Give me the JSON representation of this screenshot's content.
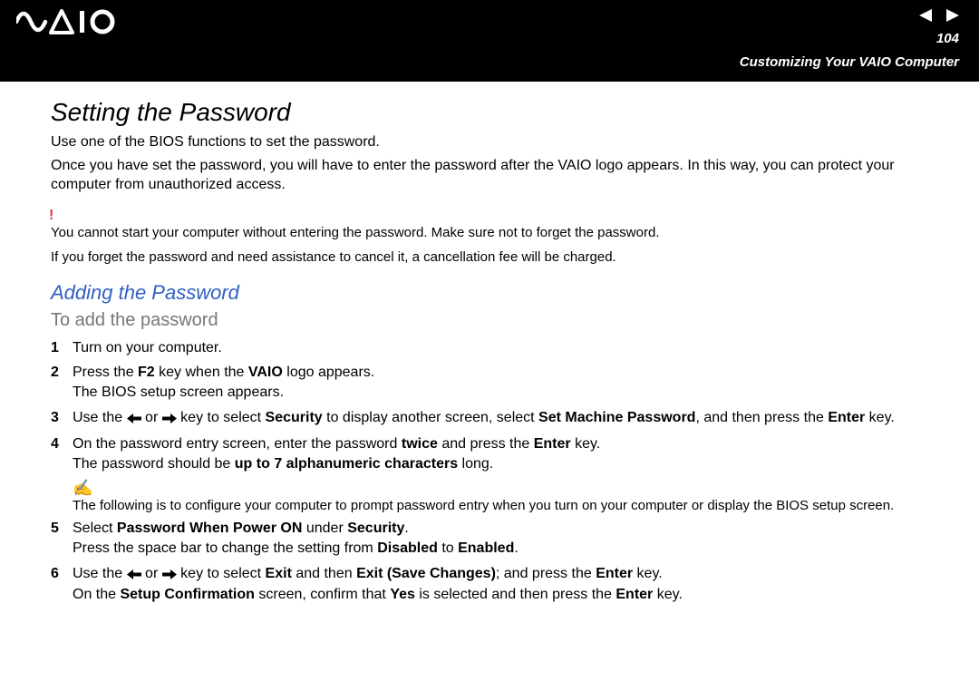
{
  "header": {
    "page_number": "104",
    "section": "Customizing Your VAIO Computer"
  },
  "main": {
    "h1": "Setting the Password",
    "intro1": "Use one of the BIOS functions to set the password.",
    "intro2": "Once you have set the password, you will have to enter the password after the VAIO logo appears. In this way, you can protect your computer from unauthorized access.",
    "warn_mark": "!",
    "warn1": "You cannot start your computer without entering the password. Make sure not to forget the password.",
    "warn2": "If you forget the password and need assistance to cancel it, a cancellation fee will be charged.",
    "h2": "Adding the Password",
    "h3": "To add the password",
    "steps": {
      "n1": "1",
      "t1": "Turn on your computer.",
      "n2": "2",
      "t2a": "Press the ",
      "t2b": "F2",
      "t2c": " key when the ",
      "t2d": "VAIO",
      "t2e": " logo appears.",
      "t2f": "The BIOS setup screen appears.",
      "n3": "3",
      "t3a": "Use the ",
      "t3b": " or ",
      "t3c": " key to select ",
      "t3d": "Security",
      "t3e": " to display another screen, select ",
      "t3f": "Set Machine Password",
      "t3g": ", and then press the ",
      "t3h": "Enter",
      "t3i": " key.",
      "n4": "4",
      "t4a": "On the password entry screen, enter the password ",
      "t4b": "twice",
      "t4c": " and press the ",
      "t4d": "Enter",
      "t4e": " key.",
      "t4f": "The password should be ",
      "t4g": "up to 7 alphanumeric characters",
      "t4h": " long.",
      "note_mark": "✍",
      "note": "The following is to configure your computer to prompt password entry when you turn on your computer or display the BIOS setup screen.",
      "n5": "5",
      "t5a": "Select ",
      "t5b": "Password When Power ON",
      "t5c": " under ",
      "t5d": "Security",
      "t5e": ".",
      "t5f": "Press the space bar to change the setting from ",
      "t5g": "Disabled",
      "t5h": " to ",
      "t5i": "Enabled",
      "t5j": ".",
      "n6": "6",
      "t6a": "Use the ",
      "t6b": " or ",
      "t6c": " key to select ",
      "t6d": "Exit",
      "t6e": " and then ",
      "t6f": "Exit (Save Changes)",
      "t6g": "; and press the ",
      "t6h": "Enter",
      "t6i": " key.",
      "t6j": "On the ",
      "t6k": "Setup Confirmation",
      "t6l": " screen, confirm that ",
      "t6m": "Yes",
      "t6n": " is selected and then press the ",
      "t6o": "Enter",
      "t6p": " key."
    }
  }
}
